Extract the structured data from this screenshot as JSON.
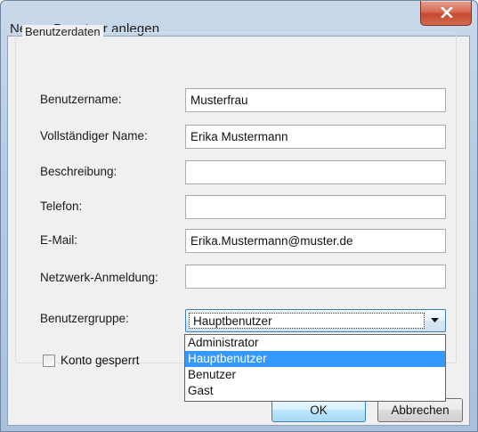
{
  "window": {
    "title": "Neuen Benutzer anlegen",
    "close_icon": "close-icon"
  },
  "group": {
    "legend": "Benutzerdaten"
  },
  "fields": {
    "username": {
      "label": "Benutzername:",
      "value": "Musterfrau"
    },
    "fullname": {
      "label": "Vollständiger Name:",
      "value": "Erika Mustermann"
    },
    "description": {
      "label": "Beschreibung:",
      "value": ""
    },
    "phone": {
      "label": "Telefon:",
      "value": ""
    },
    "email": {
      "label": "E-Mail:",
      "value": "Erika.Mustermann@muster.de"
    },
    "network_login": {
      "label": "Netzwerk-Anmeldung:",
      "value": ""
    }
  },
  "usergroup": {
    "label": "Benutzergruppe:",
    "selected": "Hauptbenutzer",
    "options": [
      "Administrator",
      "Hauptbenutzer",
      "Benutzer",
      "Gast"
    ],
    "highlighted_index": 1
  },
  "account_locked": {
    "label": "Konto gesperrt",
    "checked": false
  },
  "buttons": {
    "ok": "OK",
    "cancel": "Abbrechen"
  },
  "colors": {
    "selection": "#3399ff",
    "close_button": "#c44a2f",
    "frame": "#b5cbe2"
  }
}
